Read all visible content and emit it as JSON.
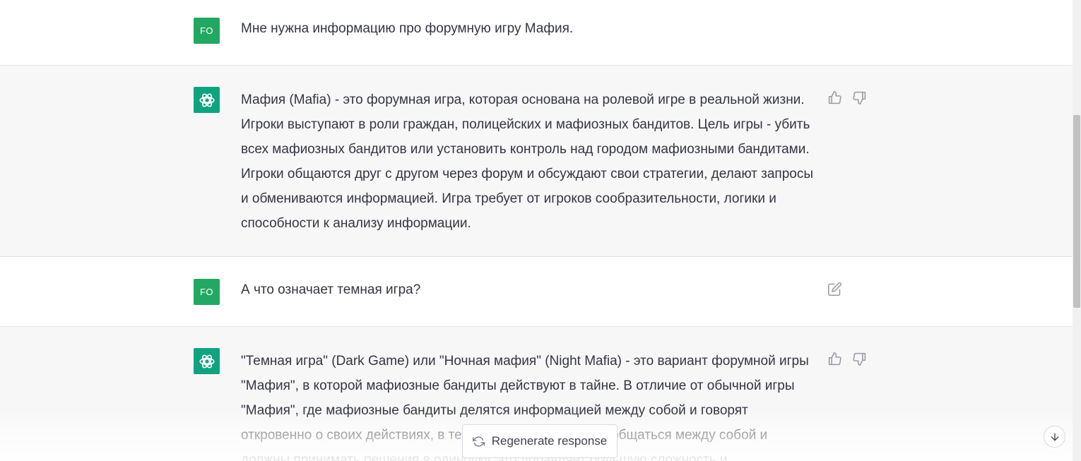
{
  "messages": [
    {
      "role": "user",
      "avatar": "FO",
      "text": "Мне нужна информацию про форумную игру Мафия."
    },
    {
      "role": "assistant",
      "avatar_icon": "openai-logo-icon",
      "text": "Мафия (Mafia) - это форумная игра, которая основана на ролевой игре в реальной жизни. Игроки выступают в роли граждан, полицейских и мафиозных бандитов. Цель игры - убить всех мафиозных бандитов или установить контроль над городом мафиозными бандитами. Игроки общаются друг с другом через форум и обсуждают свои стратегии, делают запросы и обмениваются информацией. Игра требует от игроков сообразительности, логики и способности к анализу информации."
    },
    {
      "role": "user",
      "avatar": "FO",
      "text": "А что означает темная игра?"
    },
    {
      "role": "assistant",
      "avatar_icon": "openai-logo-icon",
      "text": "\"Темная игра\" (Dark Game) или \"Ночная мафия\" (Night Mafia) - это вариант форумной игры \"Мафия\", в которой мафиозные бандиты действуют в тайне. В отличие от обычной игры \"Мафия\", где мафиозные бандиты делятся информацией между собой и говорят откровенно о своих действиях, в темной игре они не могут общаться между собой и должны принимать решения в одиночку, это добавляет большую сложность и"
    }
  ],
  "controls": {
    "regenerate_label": "Regenerate response",
    "regenerate_icon": "refresh-icon",
    "scroll_down_icon": "arrow-down-icon",
    "like_icon": "thumbs-up-icon",
    "dislike_icon": "thumbs-down-icon",
    "edit_icon": "edit-icon"
  },
  "colors": {
    "user_avatar": "#22a862",
    "assistant_avatar": "#10a37f",
    "assistant_bg": "#f7f7f8",
    "text": "#343541"
  }
}
